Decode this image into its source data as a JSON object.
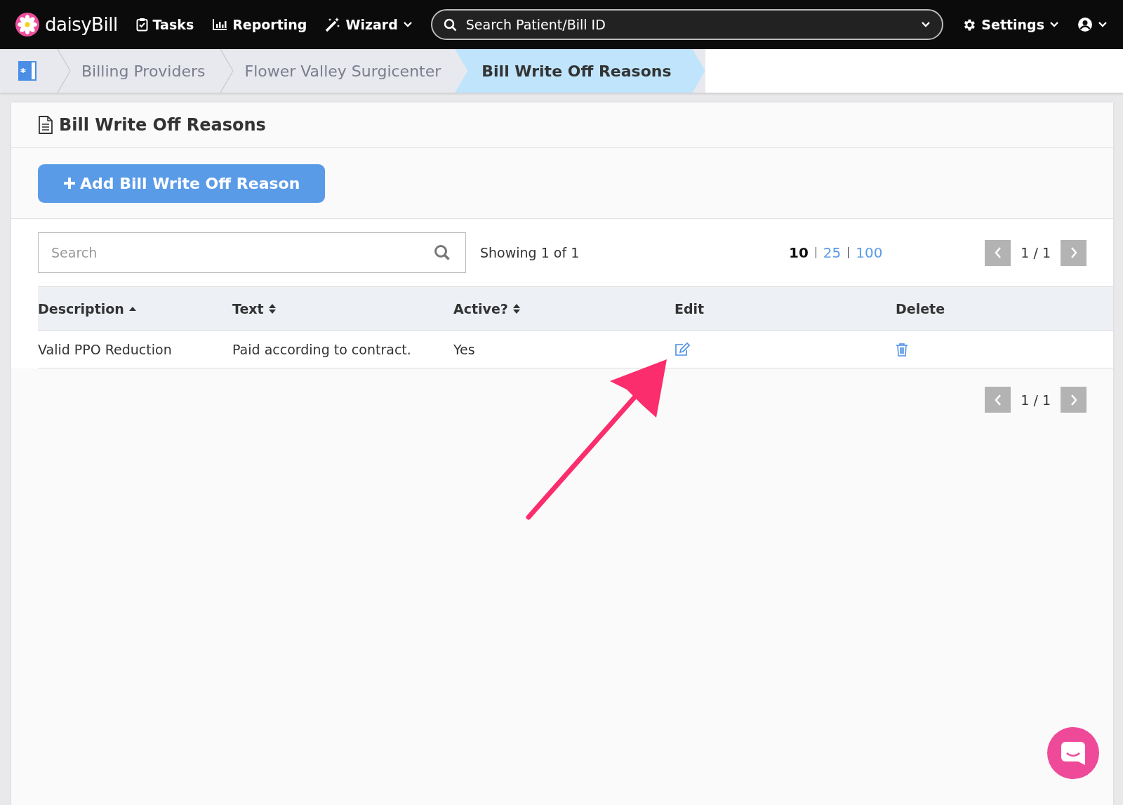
{
  "navbar": {
    "logo": "daisyBill",
    "items": [
      {
        "label": "Tasks",
        "kind": "tasks",
        "dropdown": false
      },
      {
        "label": "Reporting",
        "kind": "reporting",
        "dropdown": false
      },
      {
        "label": "Wizard",
        "kind": "wizard",
        "dropdown": true
      }
    ],
    "search": {
      "placeholder": "Search Patient/Bill ID"
    },
    "settings": {
      "label": "Settings"
    }
  },
  "breadcrumbs": [
    {
      "label": "Billing Providers",
      "selected": false
    },
    {
      "label": "Flower Valley Surgicenter",
      "selected": false
    },
    {
      "label": "Bill Write Off Reasons",
      "selected": true
    }
  ],
  "card": {
    "title": "Bill Write Off Reasons",
    "add_button": "Add Bill Write Off Reason",
    "search": {
      "placeholder": "Search"
    },
    "showing": "Showing 1 of 1",
    "page_sizes": [
      {
        "label": "10",
        "selected": true
      },
      {
        "label": "25",
        "selected": false
      },
      {
        "label": "100",
        "selected": false
      }
    ],
    "pager_top": "1 / 1",
    "pager_bottom": "1 / 1",
    "table": {
      "columns": [
        {
          "label": "Description",
          "sortable": true,
          "sorted": true
        },
        {
          "label": "Text",
          "sortable": true,
          "sorted": false
        },
        {
          "label": "Active?",
          "sortable": true,
          "sorted": false
        },
        {
          "label": "Edit",
          "sortable": false
        },
        {
          "label": "Delete",
          "sortable": false
        }
      ],
      "rows": [
        {
          "description": "Valid PPO Reduction",
          "text": "Paid according to contract.",
          "active": "Yes"
        }
      ]
    }
  }
}
